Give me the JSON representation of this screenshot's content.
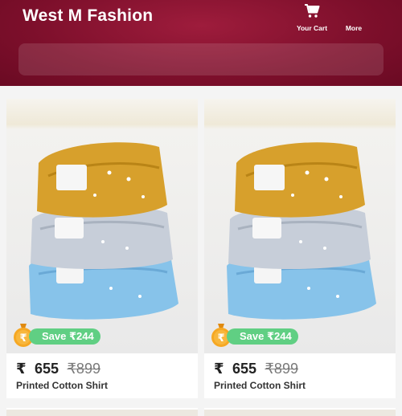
{
  "header": {
    "brand": "West M Fashion",
    "cart_label": "Your Cart",
    "more_label": "More",
    "colors": {
      "background": "#7d0f2b",
      "text": "#ffffff"
    }
  },
  "search": {
    "value": "",
    "placeholder": ""
  },
  "products": [
    {
      "title": "Printed Cotton Shirt",
      "currency": "₹",
      "price": "655",
      "mrp": "₹899",
      "save_label": "Save ₹244",
      "image": "stack of folded printed shirts: mustard, grey, light blue"
    },
    {
      "title": "Printed Cotton Shirt",
      "currency": "₹",
      "price": "655",
      "mrp": "₹899",
      "save_label": "Save ₹244",
      "image": "stack of folded printed shirts: mustard, grey, light blue"
    }
  ],
  "icons": {
    "cart": "cart-icon",
    "more": "more-icon",
    "coin": "rupee-coin-icon"
  },
  "colors": {
    "save_badge": "#60cf83",
    "price": "#222222",
    "mrp": "#7a7a7a"
  }
}
